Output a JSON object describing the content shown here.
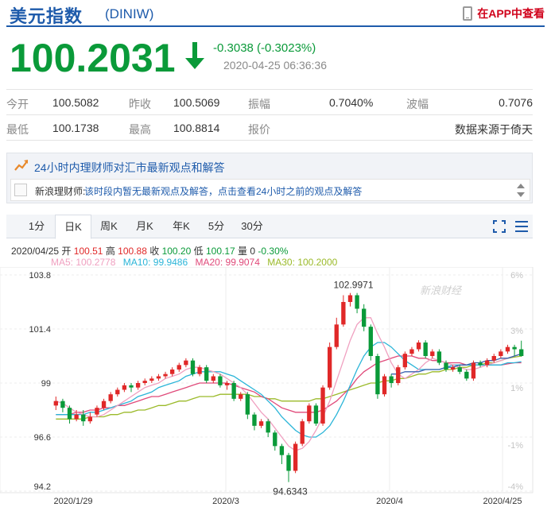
{
  "header": {
    "title": "美元指数",
    "code": "(DINIW)",
    "app_link": "在APP中查看"
  },
  "quote": {
    "price": "100.2031",
    "change": "-0.3038 (-0.3023%)",
    "timestamp": "2020-04-25 06:36:36"
  },
  "stats": [
    [
      {
        "label": "今开",
        "value": "100.5082"
      },
      {
        "label": "昨收",
        "value": "100.5069"
      },
      {
        "label": "振幅",
        "value": "0.7040%"
      },
      {
        "label": "波幅",
        "value": "0.7076"
      }
    ],
    [
      {
        "label": "最低",
        "value": "100.1738"
      },
      {
        "label": "最高",
        "value": "100.8814"
      },
      {
        "label": "报价",
        "value": "数据来源于倚天"
      }
    ]
  ],
  "advisor": {
    "title": "24小时内理财师对汇市最新观点和解答",
    "name": "新浪理财师:",
    "message": "该时段内暂无最新观点及解答，点击查看24小时之前的观点及解答"
  },
  "tabs": [
    "1分",
    "日K",
    "周K",
    "月K",
    "年K",
    "5分",
    "30分"
  ],
  "active_tab": "日K",
  "info": {
    "date": "2020/04/25",
    "open_label": "开",
    "open": "100.51",
    "high_label": "高",
    "high": "100.88",
    "close_label": "收",
    "close": "100.20",
    "low_label": "低",
    "low": "100.17",
    "volume_label": "量",
    "volume": "0",
    "change": "-0.30%"
  },
  "ma": {
    "ma5": "MA5: 100.2778",
    "ma10": "MA10: 99.9486",
    "ma20": "MA20: 99.9074",
    "ma30": "MA30: 100.2000"
  },
  "colors": {
    "up": "#e02828",
    "down": "#0a9a39",
    "ma5": "#f0a0c0",
    "ma10": "#2bb5d8",
    "ma20": "#e04a7a",
    "ma30": "#9bba2a",
    "ma_extra": "#3a62b0"
  },
  "chart_data": {
    "type": "candlestick",
    "y_ticks_left": [
      "103.8",
      "101.4",
      "99",
      "96.6",
      "94.2"
    ],
    "y_ticks_right": [
      "6%",
      "3%",
      "1%",
      "-1%",
      "-4%"
    ],
    "x_ticks": [
      "2020/1/29",
      "2020/3",
      "2020/4",
      "2020/4/25"
    ],
    "ylim": [
      94.2,
      103.8
    ],
    "max_label": "102.9971",
    "min_label": "94.6343",
    "watermark": "新浪财经",
    "candles": [
      [
        98.0,
        98.2,
        97.8,
        98.4
      ],
      [
        98.2,
        97.9,
        97.7,
        98.3
      ],
      [
        97.9,
        97.4,
        97.2,
        98.0
      ],
      [
        97.4,
        97.6,
        97.3,
        97.8
      ],
      [
        97.6,
        97.3,
        97.1,
        97.8
      ],
      [
        97.3,
        97.5,
        97.2,
        97.7
      ],
      [
        97.6,
        97.9,
        97.5,
        98.0
      ],
      [
        97.9,
        98.2,
        97.8,
        98.3
      ],
      [
        98.2,
        98.5,
        98.1,
        98.6
      ],
      [
        98.5,
        98.7,
        98.4,
        98.8
      ],
      [
        98.7,
        98.9,
        98.6,
        99.0
      ],
      [
        98.9,
        98.8,
        98.6,
        99.0
      ],
      [
        98.8,
        99.0,
        98.7,
        99.1
      ],
      [
        99.0,
        99.1,
        98.9,
        99.2
      ],
      [
        99.1,
        99.2,
        99.0,
        99.3
      ],
      [
        99.2,
        99.3,
        99.1,
        99.4
      ],
      [
        99.3,
        99.4,
        99.2,
        99.5
      ],
      [
        99.4,
        99.6,
        99.3,
        99.7
      ],
      [
        99.6,
        99.8,
        99.5,
        99.9
      ],
      [
        99.8,
        100.0,
        99.7,
        100.1
      ],
      [
        100.0,
        99.4,
        99.3,
        100.1
      ],
      [
        99.4,
        99.7,
        99.3,
        99.8
      ],
      [
        99.7,
        99.1,
        99.0,
        99.8
      ],
      [
        99.1,
        99.3,
        99.0,
        99.4
      ],
      [
        99.3,
        98.9,
        98.8,
        99.4
      ],
      [
        98.9,
        99.0,
        98.7,
        99.1
      ],
      [
        99.0,
        98.3,
        98.2,
        99.1
      ],
      [
        98.3,
        98.5,
        98.2,
        98.6
      ],
      [
        98.5,
        97.6,
        97.4,
        98.6
      ],
      [
        97.6,
        97.1,
        96.9,
        97.7
      ],
      [
        97.1,
        97.3,
        97.0,
        97.4
      ],
      [
        97.3,
        96.8,
        96.6,
        97.4
      ],
      [
        96.8,
        96.2,
        96.0,
        96.9
      ],
      [
        96.2,
        95.8,
        95.4,
        96.3
      ],
      [
        95.8,
        95.1,
        94.6,
        95.9
      ],
      [
        95.1,
        96.3,
        95.0,
        96.4
      ],
      [
        96.3,
        97.3,
        96.2,
        97.4
      ],
      [
        97.3,
        98.0,
        97.2,
        98.1
      ],
      [
        98.0,
        97.2,
        97.1,
        98.1
      ],
      [
        97.2,
        98.8,
        97.1,
        98.9
      ],
      [
        98.8,
        100.6,
        98.7,
        100.8
      ],
      [
        100.6,
        101.6,
        100.5,
        101.9
      ],
      [
        101.6,
        102.6,
        101.5,
        102.9
      ],
      [
        102.6,
        102.9,
        102.4,
        103.0
      ],
      [
        102.9,
        102.3,
        102.1,
        103.0
      ],
      [
        102.3,
        101.5,
        101.3,
        102.5
      ],
      [
        101.5,
        100.2,
        100.0,
        101.6
      ],
      [
        100.2,
        98.5,
        98.3,
        100.3
      ],
      [
        98.5,
        99.3,
        98.4,
        99.4
      ],
      [
        99.3,
        99.0,
        98.8,
        99.4
      ],
      [
        99.0,
        99.7,
        98.9,
        99.8
      ],
      [
        99.7,
        100.3,
        99.6,
        100.4
      ],
      [
        100.3,
        100.5,
        100.2,
        100.6
      ],
      [
        100.5,
        100.8,
        100.4,
        100.9
      ],
      [
        100.8,
        100.2,
        100.1,
        100.9
      ],
      [
        100.2,
        100.4,
        100.1,
        100.5
      ],
      [
        100.4,
        99.9,
        99.8,
        100.5
      ],
      [
        99.9,
        99.6,
        99.5,
        100.0
      ],
      [
        99.6,
        99.7,
        99.5,
        99.8
      ],
      [
        99.7,
        99.5,
        99.4,
        99.8
      ],
      [
        99.5,
        99.2,
        99.1,
        99.6
      ],
      [
        99.2,
        99.9,
        99.1,
        100.0
      ],
      [
        99.9,
        99.8,
        99.7,
        100.0
      ],
      [
        99.8,
        100.0,
        99.7,
        100.1
      ],
      [
        100.0,
        100.2,
        99.9,
        100.3
      ],
      [
        100.2,
        100.4,
        100.1,
        100.5
      ],
      [
        100.4,
        100.6,
        100.3,
        100.7
      ],
      [
        100.6,
        100.5,
        100.2,
        100.7
      ],
      [
        100.5,
        100.2,
        100.17,
        100.88
      ]
    ],
    "ma5": [
      98.2,
      98.1,
      97.9,
      97.7,
      97.6,
      97.5,
      97.5,
      97.6,
      97.8,
      98.0,
      98.2,
      98.4,
      98.6,
      98.8,
      98.9,
      99.0,
      99.2,
      99.3,
      99.4,
      99.6,
      99.7,
      99.7,
      99.6,
      99.5,
      99.4,
      99.2,
      99.0,
      98.8,
      98.5,
      98.1,
      97.7,
      97.4,
      97.0,
      96.6,
      96.2,
      96.0,
      96.1,
      96.4,
      96.9,
      97.5,
      98.2,
      99.1,
      100.0,
      100.9,
      101.6,
      101.9,
      101.9,
      101.2,
      100.6,
      99.9,
      99.4,
      99.2,
      99.4,
      99.6,
      99.9,
      100.1,
      100.0,
      99.9,
      99.8,
      99.7,
      99.6,
      99.6,
      99.7,
      99.8,
      99.9,
      100.0,
      100.1,
      100.2,
      100.3
    ],
    "ma10": [
      97.6,
      97.6,
      97.6,
      97.6,
      97.6,
      97.7,
      97.7,
      97.8,
      97.9,
      98.0,
      98.1,
      98.2,
      98.4,
      98.5,
      98.6,
      98.8,
      98.9,
      99.0,
      99.1,
      99.3,
      99.4,
      99.5,
      99.5,
      99.5,
      99.5,
      99.4,
      99.3,
      99.1,
      98.9,
      98.7,
      98.5,
      98.2,
      97.9,
      97.5,
      97.2,
      96.9,
      96.7,
      96.6,
      96.6,
      96.8,
      97.1,
      97.6,
      98.2,
      98.9,
      99.6,
      100.2,
      100.6,
      100.8,
      100.8,
      100.6,
      100.3,
      100.0,
      99.8,
      99.6,
      99.6,
      99.6,
      99.6,
      99.7,
      99.8,
      99.8,
      99.8,
      99.8,
      99.8,
      99.8,
      99.8,
      99.8,
      99.9,
      99.9,
      99.95
    ],
    "ma20": [
      97.6,
      97.6,
      97.6,
      97.7,
      97.7,
      97.8,
      97.8,
      97.9,
      97.9,
      98.0,
      98.0,
      98.1,
      98.2,
      98.3,
      98.4,
      98.4,
      98.5,
      98.6,
      98.7,
      98.8,
      98.9,
      99.0,
      99.0,
      99.0,
      99.0,
      99.0,
      98.9,
      98.8,
      98.7,
      98.6,
      98.4,
      98.3,
      98.1,
      97.9,
      97.8,
      97.7,
      97.7,
      97.7,
      97.7,
      97.8,
      98.0,
      98.2,
      98.5,
      98.8,
      99.2,
      99.5,
      99.7,
      99.9,
      100.0,
      100.1,
      100.2,
      100.2,
      100.2,
      100.1,
      100.1,
      100.0,
      100.0,
      99.9,
      99.9,
      99.9,
      99.8,
      99.8,
      99.8,
      99.8,
      99.8,
      99.8,
      99.85,
      99.9,
      99.9
    ],
    "ma30": [
      97.4,
      97.4,
      97.4,
      97.4,
      97.4,
      97.5,
      97.5,
      97.5,
      97.6,
      97.6,
      97.7,
      97.7,
      97.8,
      97.8,
      97.9,
      98.0,
      98.0,
      98.1,
      98.2,
      98.2,
      98.3,
      98.4,
      98.4,
      98.4,
      98.5,
      98.5,
      98.5,
      98.5,
      98.5,
      98.4,
      98.4,
      98.3,
      98.3,
      98.2,
      98.2,
      98.2,
      98.2,
      98.2,
      98.3,
      98.3,
      98.4,
      98.5,
      98.6,
      98.7,
      98.8,
      98.9,
      99.0,
      99.0,
      99.1,
      99.1,
      99.2,
      99.2,
      99.3,
      99.4,
      99.4,
      99.5,
      99.5,
      99.6,
      99.6,
      99.7,
      99.7,
      99.8,
      99.8,
      99.9,
      99.9,
      100.0,
      100.1,
      100.15,
      100.2
    ],
    "ma_extra": [
      99.4,
      99.4,
      99.5,
      99.5,
      99.5,
      99.6,
      99.6,
      99.6,
      99.7,
      99.7,
      99.8,
      99.8,
      99.9,
      99.9,
      100.0,
      100.0,
      100.1,
      100.1,
      100.2,
      100.3
    ]
  }
}
